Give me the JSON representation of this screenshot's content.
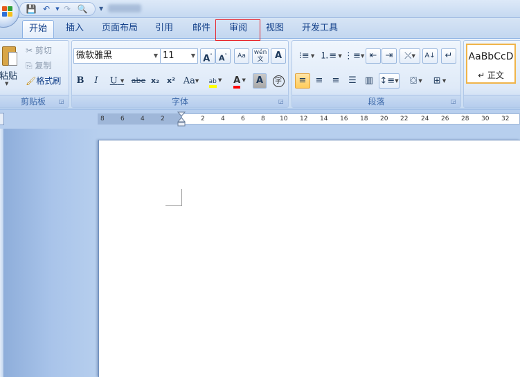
{
  "qat": {
    "save": "💾",
    "undo": "↶",
    "redo": "↷",
    "preview": "🔍",
    "more": "▼"
  },
  "tabs": [
    {
      "label": "开始"
    },
    {
      "label": "插入"
    },
    {
      "label": "页面布局"
    },
    {
      "label": "引用"
    },
    {
      "label": "邮件"
    },
    {
      "label": "审阅"
    },
    {
      "label": "视图"
    },
    {
      "label": "开发工具"
    }
  ],
  "clipboard": {
    "paste": "粘贴",
    "paste_arrow": "▼",
    "cut": "剪切",
    "copy": "复制",
    "format_painter": "格式刷",
    "label": "剪贴板"
  },
  "font": {
    "name": "微软雅黑",
    "size": "11",
    "label": "字体",
    "bold": "B",
    "italic": "I",
    "underline": "U",
    "strike": "abe",
    "subscript": "x₂",
    "superscript": "x²",
    "case": "Aa",
    "grow": "A",
    "shrink": "A",
    "clear": "Aa",
    "phonetic": "wén",
    "border": "A",
    "highlight": "ab",
    "color": "A",
    "shade": "A",
    "enclose": "字"
  },
  "paragraph": {
    "label": "段落"
  },
  "styles": {
    "sample": "AaBbCcD",
    "name": "↵ 正文"
  },
  "ruler": {
    "ticks": [
      "8",
      "6",
      "4",
      "2",
      "2",
      "4",
      "6",
      "8",
      "10",
      "12",
      "14",
      "16",
      "18",
      "20",
      "22",
      "24",
      "26",
      "28",
      "30",
      "32"
    ]
  },
  "colors": {
    "accent": "#15428b",
    "highlight_box": "#e8242a",
    "highlight_yellow": "#ffff00",
    "font_red": "#ff0000"
  }
}
